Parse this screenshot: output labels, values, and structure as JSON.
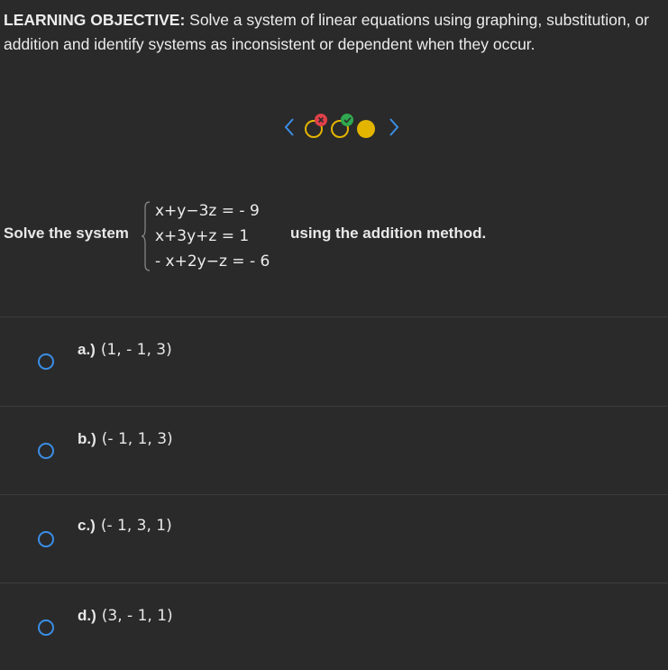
{
  "objective": {
    "label": "LEARNING OBJECTIVE:",
    "text": "Solve a system of linear equations using graphing, substitution, or addition and identify systems as inconsistent or dependent when they occur."
  },
  "nav": {
    "dots": [
      {
        "state": "incorrect",
        "badge": "×",
        "badge_color": "#e0404a"
      },
      {
        "state": "correct",
        "badge": "✓",
        "badge_color": "#2fa84f"
      },
      {
        "state": "current"
      }
    ],
    "accent_color": "#3a8ee6",
    "dot_color": "#e3b500"
  },
  "question": {
    "prefix": "Solve the system",
    "equations": [
      "x+y−3z = - 9",
      "x+3y+z = 1",
      "- x+2y−z = - 6"
    ],
    "suffix": "using the addition method."
  },
  "options": [
    {
      "letter": "a.)",
      "value": "(1,  - 1, 3)"
    },
    {
      "letter": "b.)",
      "value": "(- 1, 1, 3)"
    },
    {
      "letter": "c.)",
      "value": "(- 1, 3, 1)"
    },
    {
      "letter": "d.)",
      "value": "(3,  - 1, 1)"
    }
  ]
}
